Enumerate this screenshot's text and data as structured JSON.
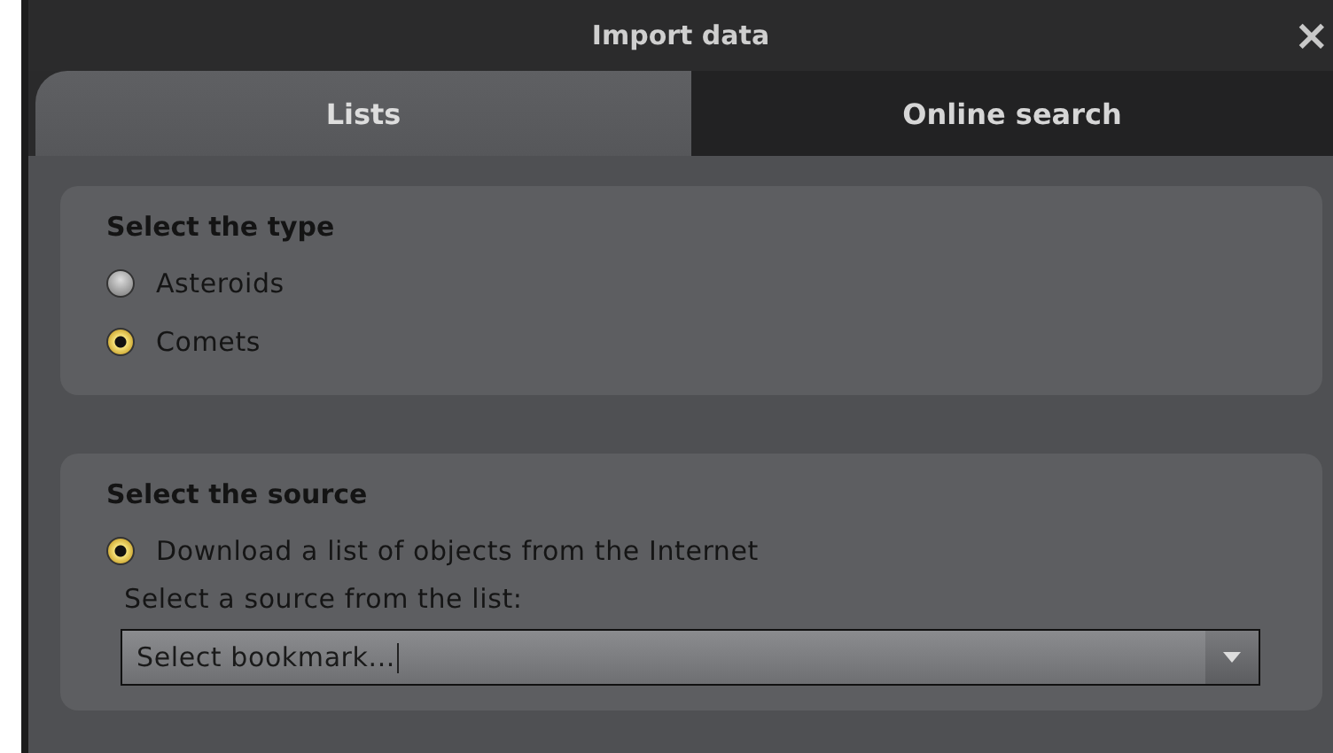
{
  "window": {
    "title": "Import data",
    "close": "×"
  },
  "tabs": [
    {
      "label": "Lists",
      "selected": true
    },
    {
      "label": "Online search",
      "selected": false
    }
  ],
  "type_group": {
    "title": "Select the type",
    "options": [
      {
        "label": "Asteroids",
        "selected": false
      },
      {
        "label": "Comets",
        "selected": true
      }
    ]
  },
  "source_group": {
    "title": "Select the source",
    "options": [
      {
        "label": "Download a list of objects from the Internet",
        "selected": true
      }
    ],
    "source_label": "Select a source from the list:",
    "bookmark_field": {
      "value": "Select bookmark..."
    }
  }
}
